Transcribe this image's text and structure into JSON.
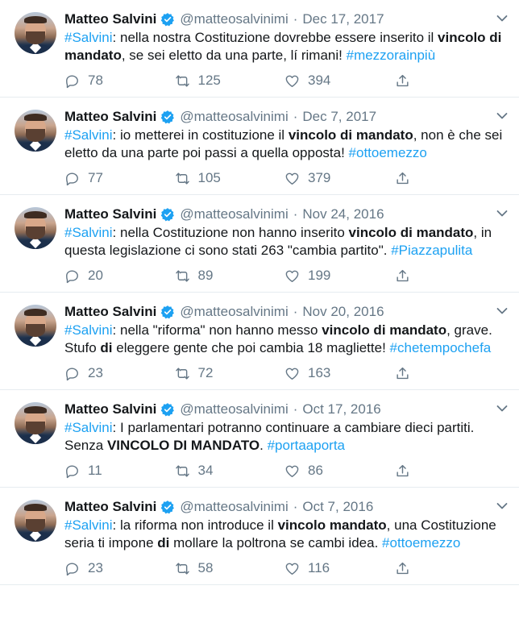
{
  "tweets": [
    {
      "name": "Matteo Salvini",
      "handle": "@matteosalvinimi",
      "date": "Dec 17, 2017",
      "text": [
        {
          "t": "#Salvini",
          "style": "hash"
        },
        {
          "t": ": nella nostra Costituzione dovrebbe essere inserito il ",
          "style": "plain"
        },
        {
          "t": "vincolo di mandato",
          "style": "bold"
        },
        {
          "t": ", se sei eletto da una parte, lí rimani! ",
          "style": "plain"
        },
        {
          "t": "#mezzorainpiù",
          "style": "hash"
        }
      ],
      "replies": "78",
      "retweets": "125",
      "likes": "394"
    },
    {
      "name": "Matteo Salvini",
      "handle": "@matteosalvinimi",
      "date": "Dec 7, 2017",
      "text": [
        {
          "t": "#Salvini",
          "style": "hash"
        },
        {
          "t": ": io metterei in costituzione il ",
          "style": "plain"
        },
        {
          "t": "vincolo di mandato",
          "style": "bold"
        },
        {
          "t": ", non è che sei eletto da una parte poi passi a quella opposta! ",
          "style": "plain"
        },
        {
          "t": "#ottoemezzo",
          "style": "hash"
        }
      ],
      "replies": "77",
      "retweets": "105",
      "likes": "379"
    },
    {
      "name": "Matteo Salvini",
      "handle": "@matteosalvinimi",
      "date": "Nov 24, 2016",
      "text": [
        {
          "t": "#Salvini",
          "style": "hash"
        },
        {
          "t": ": nella Costituzione non hanno inserito ",
          "style": "plain"
        },
        {
          "t": "vincolo di mandato",
          "style": "bold"
        },
        {
          "t": ", in questa legislazione ci sono stati 263 \"cambia partito\". ",
          "style": "plain"
        },
        {
          "t": "#Piazzapulita",
          "style": "hash"
        }
      ],
      "replies": "20",
      "retweets": "89",
      "likes": "199"
    },
    {
      "name": "Matteo Salvini",
      "handle": "@matteosalvinimi",
      "date": "Nov 20, 2016",
      "text": [
        {
          "t": "#Salvini",
          "style": "hash"
        },
        {
          "t": ": nella \"riforma\" non hanno messo ",
          "style": "plain"
        },
        {
          "t": "vincolo di mandato",
          "style": "bold"
        },
        {
          "t": ", grave. Stufo ",
          "style": "plain"
        },
        {
          "t": "di",
          "style": "bold"
        },
        {
          "t": " eleggere gente che poi cambia 18 magliette! ",
          "style": "plain"
        },
        {
          "t": "#chetempochefa",
          "style": "hash"
        }
      ],
      "replies": "23",
      "retweets": "72",
      "likes": "163"
    },
    {
      "name": "Matteo Salvini",
      "handle": "@matteosalvinimi",
      "date": "Oct 17, 2016",
      "text": [
        {
          "t": "#Salvini",
          "style": "hash"
        },
        {
          "t": ": I parlamentari potranno continuare a cambiare dieci partiti. Senza ",
          "style": "plain"
        },
        {
          "t": "VINCOLO DI MANDATO",
          "style": "bold"
        },
        {
          "t": ". ",
          "style": "plain"
        },
        {
          "t": "#portaaporta",
          "style": "hash"
        }
      ],
      "replies": "11",
      "retweets": "34",
      "likes": "86"
    },
    {
      "name": "Matteo Salvini",
      "handle": "@matteosalvinimi",
      "date": "Oct 7, 2016",
      "text": [
        {
          "t": "#Salvini",
          "style": "hash"
        },
        {
          "t": ": la riforma non introduce il ",
          "style": "plain"
        },
        {
          "t": "vincolo mandato",
          "style": "bold"
        },
        {
          "t": ", una Costituzione seria ti impone ",
          "style": "plain"
        },
        {
          "t": "di",
          "style": "bold"
        },
        {
          "t": " mollare la poltrona se cambi idea. ",
          "style": "plain"
        },
        {
          "t": "#ottoemezzo",
          "style": "hash"
        }
      ],
      "replies": "23",
      "retweets": "58",
      "likes": "116"
    }
  ],
  "icons": {
    "avatar": "profile-photo",
    "verified": "verified-badge-icon",
    "more": "chevron-down-icon",
    "reply": "reply-icon",
    "retweet": "retweet-icon",
    "like": "heart-icon",
    "share": "share-icon"
  },
  "colors": {
    "hashtag": "#1da1f2",
    "muted": "#657786",
    "text": "#14171a",
    "verified": "#1da1f2",
    "divider": "#e6ecf0"
  }
}
